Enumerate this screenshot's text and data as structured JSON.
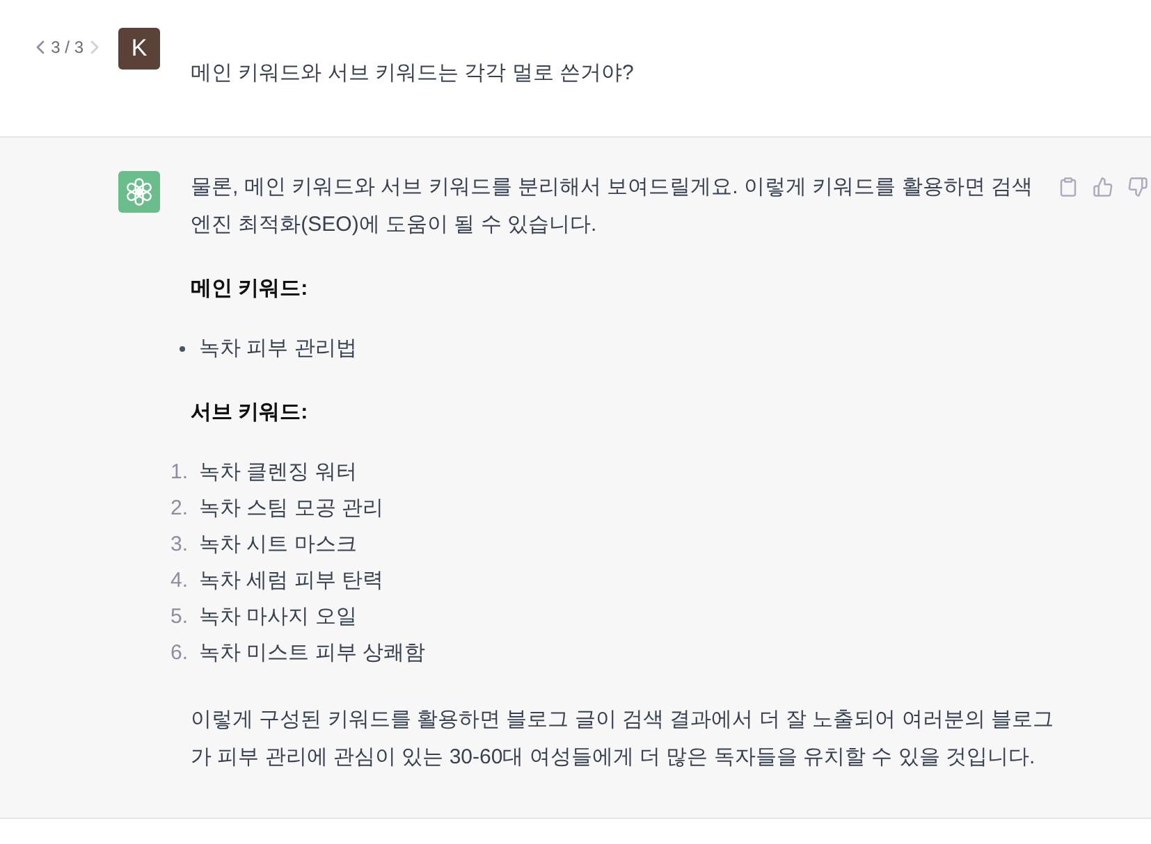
{
  "conversation": [
    {
      "kind": "user",
      "pager": {
        "label": "3 / 3",
        "prev_disabled": false,
        "next_disabled": true
      },
      "avatar_letter": "K",
      "text": "메인 키워드와 서브 키워드는 각각 멀로 쓴거야?"
    },
    {
      "kind": "assistant",
      "blocks": [
        {
          "kind": "paragraph",
          "text": "물론, 메인 키워드와 서브 키워드를 분리해서 보여드릴게요. 이렇게 키워드를 활용하면 검색 엔진 최적화(SEO)에 도움이 될 수 있습니다."
        },
        {
          "kind": "heading",
          "text": "메인 키워드:"
        },
        {
          "kind": "bullet_list",
          "items": [
            {
              "text": "녹차 피부 관리법"
            }
          ]
        },
        {
          "kind": "heading",
          "text": "서브 키워드:"
        },
        {
          "kind": "numbered_list",
          "items": [
            {
              "number": "1.",
              "text": "녹차 클렌징 워터"
            },
            {
              "number": "2.",
              "text": "녹차 스팀 모공 관리"
            },
            {
              "number": "3.",
              "text": "녹차 시트 마스크"
            },
            {
              "number": "4.",
              "text": "녹차 세럼 피부 탄력"
            },
            {
              "number": "5.",
              "text": "녹차 마사지 오일"
            },
            {
              "number": "6.",
              "text": "녹차 미스트 피부 상쾌함"
            }
          ]
        },
        {
          "kind": "paragraph",
          "text": "이렇게 구성된 키워드를 활용하면 블로그 글이 검색 결과에서 더 잘 노출되어 여러분의 블로그가 피부 관리에 관심이 있는 30-60대 여성들에게 더 많은 독자들을 유치할 수 있을 것입니다."
        }
      ]
    }
  ]
}
